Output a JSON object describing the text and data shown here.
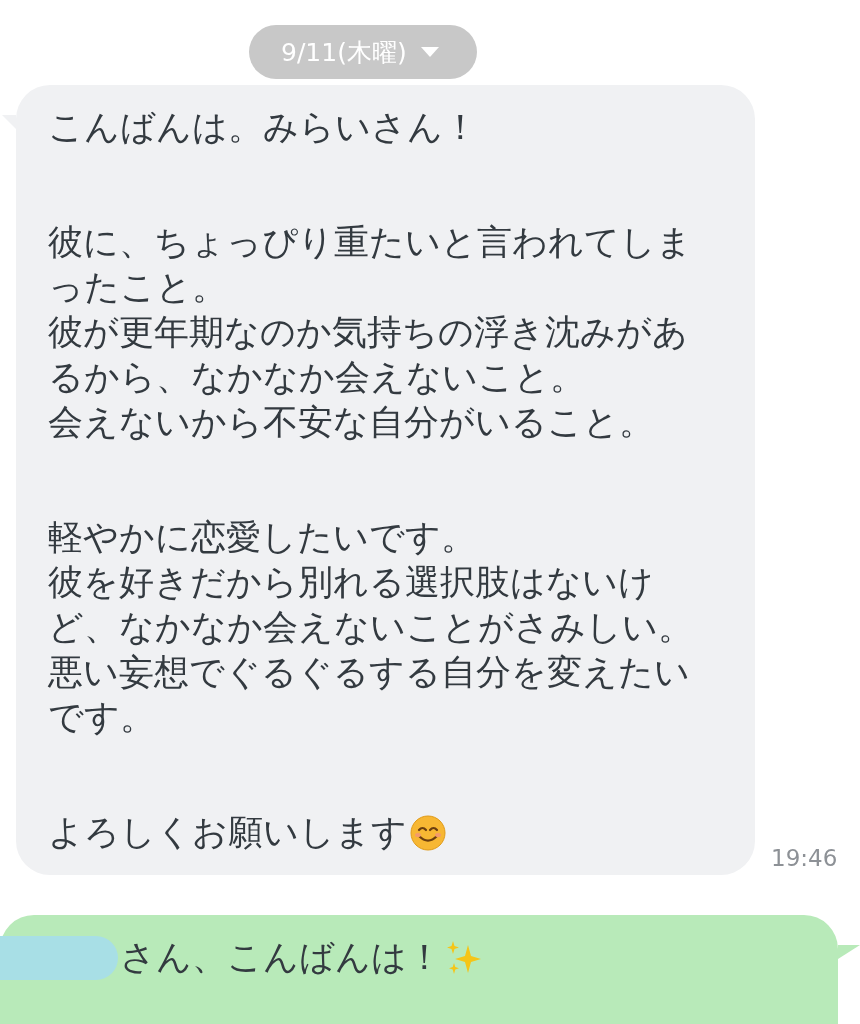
{
  "date_header": {
    "label": "9/11(木曜)",
    "dropdown": true
  },
  "messages": [
    {
      "kind": "incoming",
      "time": "19:46",
      "paragraphs": [
        {
          "lines": [
            "こんばんは。みらいさん！"
          ]
        },
        {
          "lines": [
            "彼に、ちょっぴり重たいと言われてしま",
            "ったこと。",
            "彼が更年期なのか気持ちの浮き沈みがあ",
            "るから、なかなか会えないこと。",
            "会えないから不安な自分がいること。"
          ]
        },
        {
          "lines": [
            "軽やかに恋愛したいです。",
            "彼を好きだから別れる選択肢はないけ",
            "ど、なかなか会えないことがさみしい。",
            "悪い妄想でぐるぐるする自分を変えたい",
            "です。"
          ]
        },
        {
          "lines": [
            "よろしくお願いします"
          ],
          "kind": "smile"
        }
      ]
    },
    {
      "kind": "outgoing",
      "redacted_name": true,
      "paragraphs": [
        {
          "lines": [
            "さん、こんばんは！"
          ],
          "kind": "sparkles"
        }
      ]
    }
  ]
}
